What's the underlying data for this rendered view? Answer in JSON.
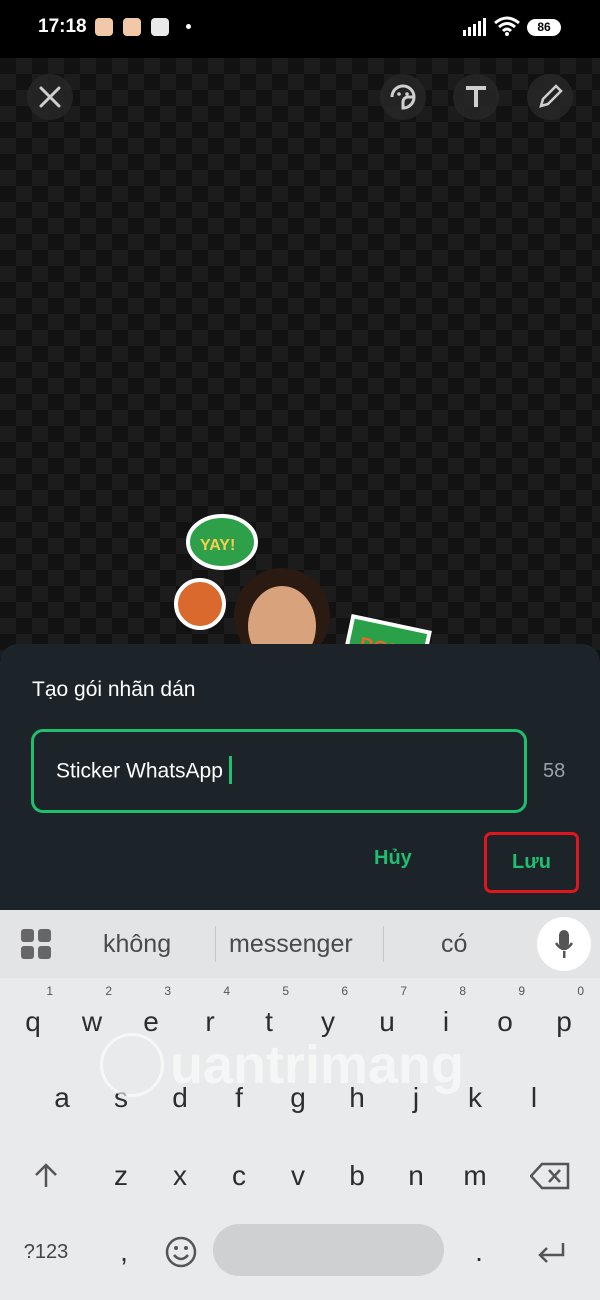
{
  "status_bar": {
    "time": "17:18",
    "battery": "86"
  },
  "toolbar": {
    "icons": [
      "close-icon",
      "sticker-icon",
      "text-icon",
      "pencil-icon"
    ]
  },
  "dialog": {
    "title": "Tạo gói nhãn dán",
    "input_value": "Sticker WhatsApp",
    "char_count": "58",
    "cancel_label": "Hủy",
    "save_label": "Lưu",
    "accent_color": "#1fbf6e",
    "highlight_color": "#e0161f"
  },
  "keyboard": {
    "suggestions": [
      "không",
      "messenger",
      "có"
    ],
    "row1": [
      {
        "key": "q",
        "num": "1"
      },
      {
        "key": "w",
        "num": "2"
      },
      {
        "key": "e",
        "num": "3"
      },
      {
        "key": "r",
        "num": "4"
      },
      {
        "key": "t",
        "num": "5"
      },
      {
        "key": "y",
        "num": "6"
      },
      {
        "key": "u",
        "num": "7"
      },
      {
        "key": "i",
        "num": "8"
      },
      {
        "key": "o",
        "num": "9"
      },
      {
        "key": "p",
        "num": "0"
      }
    ],
    "row2": [
      "a",
      "s",
      "d",
      "f",
      "g",
      "h",
      "j",
      "k",
      "l"
    ],
    "row3": [
      "z",
      "x",
      "c",
      "v",
      "b",
      "n",
      "m"
    ],
    "symbols_label": "?123",
    "comma": ",",
    "period": "."
  },
  "watermark": "uantrimang"
}
